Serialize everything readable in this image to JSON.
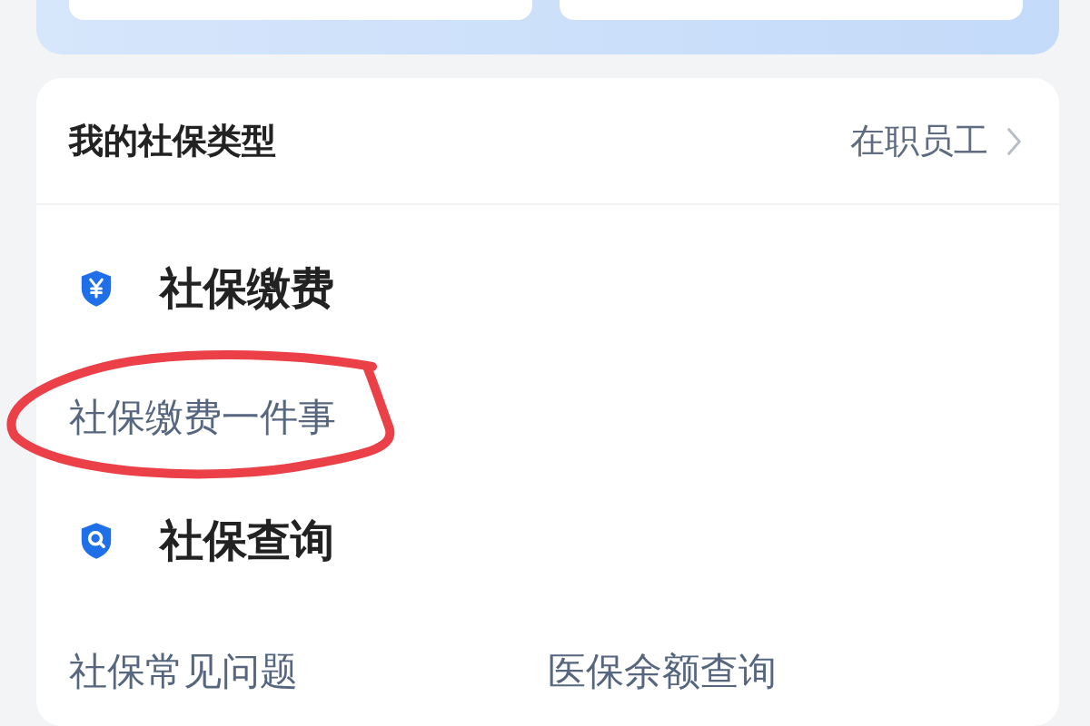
{
  "profile": {
    "label": "我的社保类型",
    "value": "在职员工"
  },
  "sections": [
    {
      "title": "社保缴费",
      "links": [
        "社保缴费一件事"
      ]
    },
    {
      "title": "社保查询",
      "links": [
        "社保常见问题",
        "医保余额查询"
      ]
    }
  ]
}
